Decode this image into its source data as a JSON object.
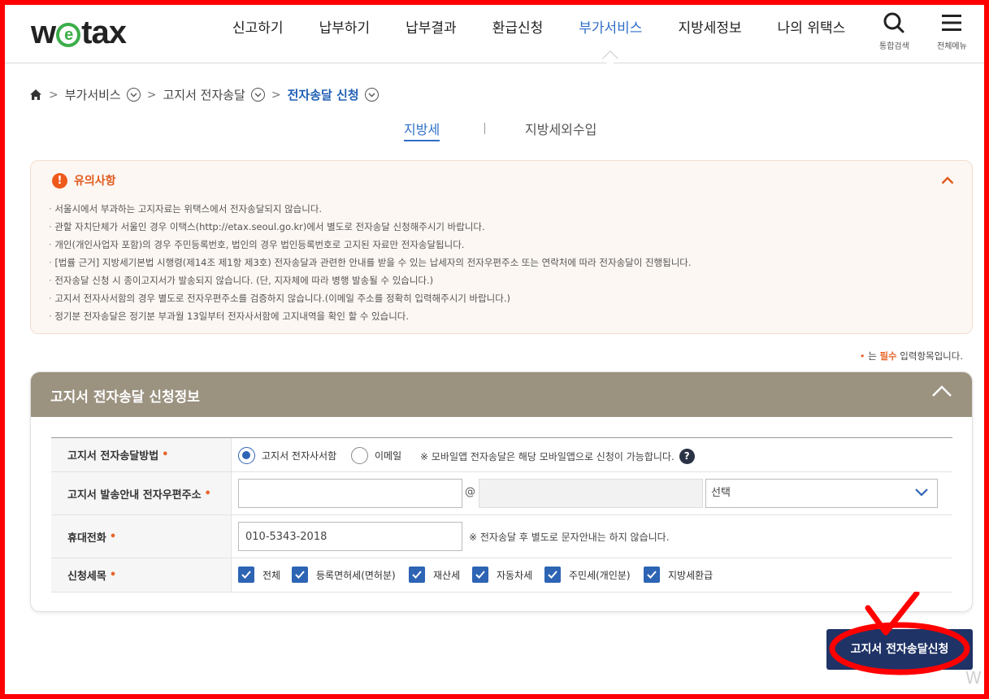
{
  "colors": {
    "frame": "#ff0000",
    "accent_blue": "#2f6fc9",
    "required": "#e8652a",
    "panel_header": "#9b9280",
    "submit_button": "#1f3366",
    "checkbox": "#2d64b4",
    "logo_e": "#3cae4a"
  },
  "logo": {
    "pre": "w",
    "e": "e",
    "post": "tax"
  },
  "nav": {
    "items": [
      "신고하기",
      "납부하기",
      "납부결과",
      "환급신청",
      "부가서비스",
      "지방세정보",
      "나의 위택스"
    ],
    "active_index": 4,
    "search_label": "통합검색",
    "menu_label": "전체메뉴"
  },
  "breadcrumb": {
    "level1": "부가서비스",
    "level2": "고지서 전자송달",
    "current": "전자송달 신청"
  },
  "tabs": {
    "active": "지방세",
    "other": "지방세외수입"
  },
  "notice": {
    "title": "유의사항",
    "items": [
      "서울시에서 부과하는 고지자료는 위택스에서 전자송달되지 않습니다.",
      "관할 자치단체가 서울인 경우 이택스(http://etax.seoul.go.kr)에서 별도로 전자송달 신청해주시기 바랍니다.",
      "개인(개인사업자 포함)의 경우 주민등록번호, 법인의 경우 법인등록번호로 고지된 자료만 전자송달됩니다.",
      "[법률 근거] 지방세기본법 시행령(제14조 제1항 제3호) 전자송달과 관련한 안내를 받을 수 있는 납세자의 전자우편주소 또는 연락처에 따라 전자송달이 진행됩니다.",
      "전자송달 신청 시 종이고지서가 발송되지 않습니다. (단, 지자체에 따라 병행 발송될 수 있습니다.)",
      "고지서 전자사서함의 경우 별도로 전자우편주소를 검증하지 않습니다.(이메일 주소를 정확히 입력해주시기 바랍니다.)",
      "정기분 전자송달은 정기분 부과월 13일부터 전자사서함에 고지내역을 확인 할 수 있습니다."
    ]
  },
  "required_note": {
    "prefix": "는",
    "bold": "필수",
    "suffix": "입력항목입니다."
  },
  "form": {
    "title": "고지서 전자송달 신청정보",
    "method": {
      "label": "고지서 전자송달방법",
      "option_inbox": "고지서 전자사서함",
      "option_email": "이메일",
      "selected": "고지서 전자사서함",
      "hint": "※ 모바일앱 전자송달은 해당 모바일앱으로 신청이 가능합니다."
    },
    "email": {
      "label": "고지서 발송안내 전자우편주소",
      "local_value": "",
      "at": "@",
      "domain_value": "",
      "select_value": "선택"
    },
    "phone": {
      "label": "휴대전화",
      "value": "010-5343-2018",
      "hint": "※ 전자송달 후 별도로 문자안내는 하지 않습니다."
    },
    "items": {
      "label": "신청세목",
      "options": [
        {
          "label": "전체",
          "checked": true
        },
        {
          "label": "등록면허세(면허분)",
          "checked": true
        },
        {
          "label": "재산세",
          "checked": true
        },
        {
          "label": "자동차세",
          "checked": true
        },
        {
          "label": "주민세(개인분)",
          "checked": true
        },
        {
          "label": "지방세환급",
          "checked": true
        }
      ]
    }
  },
  "submit_label": "고지서 전자송달신청",
  "watermark": "W"
}
